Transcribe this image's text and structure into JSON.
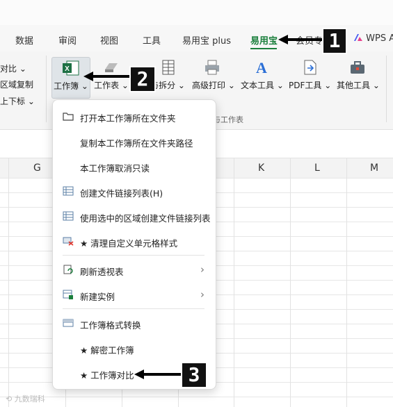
{
  "tabs": [
    {
      "label": "数据"
    },
    {
      "label": "审阅"
    },
    {
      "label": "视图"
    },
    {
      "label": "工具"
    },
    {
      "label": "易用宝 plus"
    },
    {
      "label": "易用宝"
    },
    {
      "label": "会员专"
    },
    {
      "label": "WPS A"
    }
  ],
  "ribbon_left": [
    "对比 ⌄",
    "区域复制",
    "上下标 ⌄"
  ],
  "tools": [
    {
      "label": "工作簿 ⌄",
      "icon": "excel-workbook-icon"
    },
    {
      "label": "工作表 ⌄",
      "icon": "worksheet-icon"
    },
    {
      "label": "与拆分 ⌄",
      "icon": "merge-split-icon"
    },
    {
      "label": "高级打印 ⌄",
      "icon": "printer-icon"
    },
    {
      "label": "文本工具 ⌄",
      "icon": "text-tool-icon"
    },
    {
      "label": "PDF工具 ⌄",
      "icon": "pdf-icon"
    },
    {
      "label": "其他工具 ⌄",
      "icon": "toolbox-icon"
    }
  ],
  "group_label": "与工作表",
  "columns": [
    "G",
    "K",
    "L",
    "M"
  ],
  "menu_items": [
    {
      "label": "打开本工作簿所在文件夹",
      "icon": "folder-icon",
      "has_submenu": false
    },
    {
      "label": "复制本工作簿所在文件夹路径",
      "icon": "",
      "has_submenu": false
    },
    {
      "label": "本工作簿取消只读",
      "icon": "",
      "has_submenu": false
    },
    {
      "label": "创建文件链接列表(H)",
      "icon": "list-table-icon",
      "has_submenu": false
    },
    {
      "label": "使用选中的区域创建文件链接列表",
      "icon": "list-table-icon",
      "has_submenu": false
    },
    {
      "label": "★ 清理自定义单元格样式",
      "icon": "clear-style-icon",
      "has_submenu": false
    },
    {
      "label": "刷新透视表",
      "icon": "refresh-pivot-icon",
      "has_submenu": true
    },
    {
      "label": "新建实例",
      "icon": "new-instance-icon",
      "has_submenu": true
    },
    {
      "label": "工作簿格式转换",
      "icon": "format-convert-icon",
      "has_submenu": false
    },
    {
      "label": "★ 解密工作簿",
      "icon": "",
      "has_submenu": false
    },
    {
      "label": "★ 工作簿对比",
      "icon": "",
      "has_submenu": false
    }
  ],
  "badges": [
    "1",
    "2",
    "3"
  ],
  "watermark": "⟲ 九数瑞科",
  "colors": {
    "accent": "#1a7f3c"
  }
}
